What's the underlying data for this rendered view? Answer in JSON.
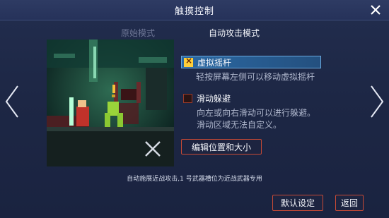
{
  "header": {
    "title": "触摸控制",
    "close_icon": "close-icon"
  },
  "tabs": [
    {
      "label": "原始模式",
      "active": false
    },
    {
      "label": "自动攻击模式",
      "active": true
    }
  ],
  "navigation": {
    "prev_icon": "chevron-left-icon",
    "next_icon": "chevron-right-icon"
  },
  "options": [
    {
      "label": "虚拟摇杆",
      "checked": true,
      "highlighted": true,
      "description": "轻按屏幕左侧可以移动虚拟摇杆"
    },
    {
      "label": "滑动躲避",
      "checked": false,
      "highlighted": false,
      "description_lines": [
        "向左或向右滑动可以进行躲避。",
        "滑动区域无法自定义。"
      ]
    }
  ],
  "edit_button": {
    "label": "编辑位置和大小"
  },
  "footer_note": "自动施展近战攻击,1 号武器槽位为近战武器专用",
  "buttons": {
    "default_label": "默认设定",
    "back_label": "返回"
  },
  "colors": {
    "background": "#1b2440",
    "highlight": "#2b69a4",
    "button_border": "#c94a35",
    "checkbox_checked": "#ffcf3a"
  }
}
